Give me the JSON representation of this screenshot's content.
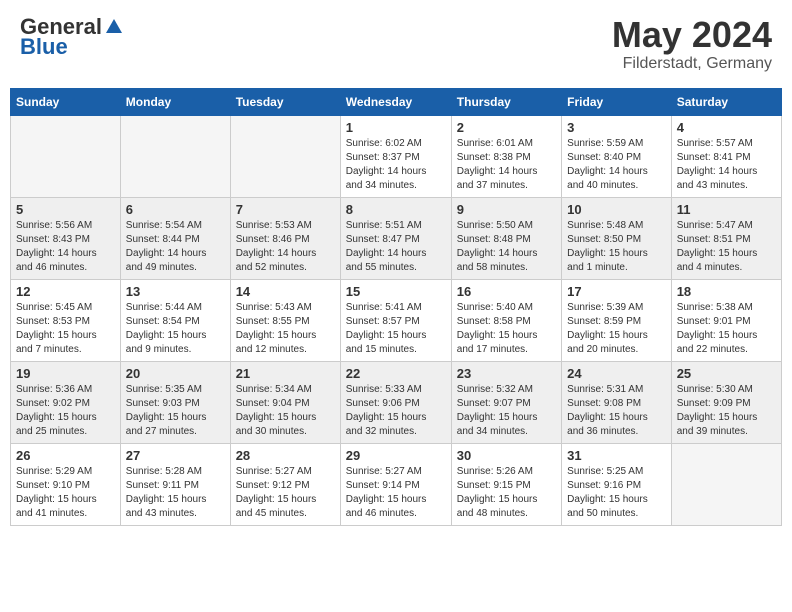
{
  "header": {
    "logo_general": "General",
    "logo_blue": "Blue",
    "month_title": "May 2024",
    "location": "Filderstadt, Germany"
  },
  "days_of_week": [
    "Sunday",
    "Monday",
    "Tuesday",
    "Wednesday",
    "Thursday",
    "Friday",
    "Saturday"
  ],
  "weeks": [
    [
      {
        "day": "",
        "info": ""
      },
      {
        "day": "",
        "info": ""
      },
      {
        "day": "",
        "info": ""
      },
      {
        "day": "1",
        "info": "Sunrise: 6:02 AM\nSunset: 8:37 PM\nDaylight: 14 hours\nand 34 minutes."
      },
      {
        "day": "2",
        "info": "Sunrise: 6:01 AM\nSunset: 8:38 PM\nDaylight: 14 hours\nand 37 minutes."
      },
      {
        "day": "3",
        "info": "Sunrise: 5:59 AM\nSunset: 8:40 PM\nDaylight: 14 hours\nand 40 minutes."
      },
      {
        "day": "4",
        "info": "Sunrise: 5:57 AM\nSunset: 8:41 PM\nDaylight: 14 hours\nand 43 minutes."
      }
    ],
    [
      {
        "day": "5",
        "info": "Sunrise: 5:56 AM\nSunset: 8:43 PM\nDaylight: 14 hours\nand 46 minutes."
      },
      {
        "day": "6",
        "info": "Sunrise: 5:54 AM\nSunset: 8:44 PM\nDaylight: 14 hours\nand 49 minutes."
      },
      {
        "day": "7",
        "info": "Sunrise: 5:53 AM\nSunset: 8:46 PM\nDaylight: 14 hours\nand 52 minutes."
      },
      {
        "day": "8",
        "info": "Sunrise: 5:51 AM\nSunset: 8:47 PM\nDaylight: 14 hours\nand 55 minutes."
      },
      {
        "day": "9",
        "info": "Sunrise: 5:50 AM\nSunset: 8:48 PM\nDaylight: 14 hours\nand 58 minutes."
      },
      {
        "day": "10",
        "info": "Sunrise: 5:48 AM\nSunset: 8:50 PM\nDaylight: 15 hours\nand 1 minute."
      },
      {
        "day": "11",
        "info": "Sunrise: 5:47 AM\nSunset: 8:51 PM\nDaylight: 15 hours\nand 4 minutes."
      }
    ],
    [
      {
        "day": "12",
        "info": "Sunrise: 5:45 AM\nSunset: 8:53 PM\nDaylight: 15 hours\nand 7 minutes."
      },
      {
        "day": "13",
        "info": "Sunrise: 5:44 AM\nSunset: 8:54 PM\nDaylight: 15 hours\nand 9 minutes."
      },
      {
        "day": "14",
        "info": "Sunrise: 5:43 AM\nSunset: 8:55 PM\nDaylight: 15 hours\nand 12 minutes."
      },
      {
        "day": "15",
        "info": "Sunrise: 5:41 AM\nSunset: 8:57 PM\nDaylight: 15 hours\nand 15 minutes."
      },
      {
        "day": "16",
        "info": "Sunrise: 5:40 AM\nSunset: 8:58 PM\nDaylight: 15 hours\nand 17 minutes."
      },
      {
        "day": "17",
        "info": "Sunrise: 5:39 AM\nSunset: 8:59 PM\nDaylight: 15 hours\nand 20 minutes."
      },
      {
        "day": "18",
        "info": "Sunrise: 5:38 AM\nSunset: 9:01 PM\nDaylight: 15 hours\nand 22 minutes."
      }
    ],
    [
      {
        "day": "19",
        "info": "Sunrise: 5:36 AM\nSunset: 9:02 PM\nDaylight: 15 hours\nand 25 minutes."
      },
      {
        "day": "20",
        "info": "Sunrise: 5:35 AM\nSunset: 9:03 PM\nDaylight: 15 hours\nand 27 minutes."
      },
      {
        "day": "21",
        "info": "Sunrise: 5:34 AM\nSunset: 9:04 PM\nDaylight: 15 hours\nand 30 minutes."
      },
      {
        "day": "22",
        "info": "Sunrise: 5:33 AM\nSunset: 9:06 PM\nDaylight: 15 hours\nand 32 minutes."
      },
      {
        "day": "23",
        "info": "Sunrise: 5:32 AM\nSunset: 9:07 PM\nDaylight: 15 hours\nand 34 minutes."
      },
      {
        "day": "24",
        "info": "Sunrise: 5:31 AM\nSunset: 9:08 PM\nDaylight: 15 hours\nand 36 minutes."
      },
      {
        "day": "25",
        "info": "Sunrise: 5:30 AM\nSunset: 9:09 PM\nDaylight: 15 hours\nand 39 minutes."
      }
    ],
    [
      {
        "day": "26",
        "info": "Sunrise: 5:29 AM\nSunset: 9:10 PM\nDaylight: 15 hours\nand 41 minutes."
      },
      {
        "day": "27",
        "info": "Sunrise: 5:28 AM\nSunset: 9:11 PM\nDaylight: 15 hours\nand 43 minutes."
      },
      {
        "day": "28",
        "info": "Sunrise: 5:27 AM\nSunset: 9:12 PM\nDaylight: 15 hours\nand 45 minutes."
      },
      {
        "day": "29",
        "info": "Sunrise: 5:27 AM\nSunset: 9:14 PM\nDaylight: 15 hours\nand 46 minutes."
      },
      {
        "day": "30",
        "info": "Sunrise: 5:26 AM\nSunset: 9:15 PM\nDaylight: 15 hours\nand 48 minutes."
      },
      {
        "day": "31",
        "info": "Sunrise: 5:25 AM\nSunset: 9:16 PM\nDaylight: 15 hours\nand 50 minutes."
      },
      {
        "day": "",
        "info": ""
      }
    ]
  ]
}
